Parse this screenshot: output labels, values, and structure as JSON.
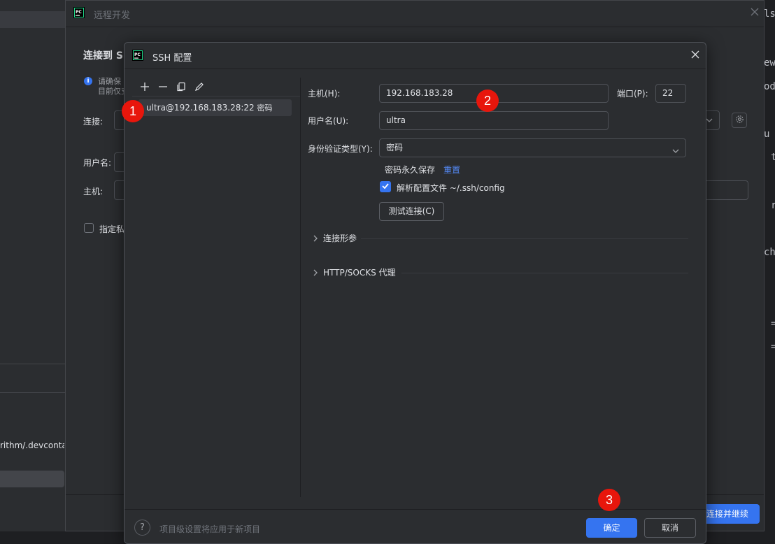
{
  "background": {
    "left_path_text": "rithm/.devcontai",
    "right_code_fragments": [
      "ls",
      "ew",
      "od",
      "u",
      "t",
      "r",
      "ch",
      "=",
      "="
    ]
  },
  "remote_window": {
    "title": "远程开发",
    "heading": "连接到 S",
    "info_line1": "请确保",
    "info_line2": "目前仅支",
    "connection_label": "连接:",
    "username_label": "用户名:",
    "host_label": "主机:",
    "private_key_label": "指定私",
    "continue_button": "连接并继续"
  },
  "ssh_dialog": {
    "title": "SSH 配置",
    "connection_list": [
      {
        "label": "ultra@192.168.183.28:22",
        "auth": "密码"
      }
    ],
    "host_label": "主机(H):",
    "host_value": "192.168.183.28",
    "port_label": "端口(P):",
    "port_value": "22",
    "username_label": "用户名(U):",
    "username_value": "ultra",
    "auth_type_label": "身份验证类型(Y):",
    "auth_type_value": "密码",
    "password_save_text": "密码永久保存",
    "reset_link": "重置",
    "parse_config_label": "解析配置文件 ~/.ssh/config",
    "parse_config_checked": true,
    "test_connection_button": "测试连接(C)",
    "section_connection_params": "连接形参",
    "section_proxy": "HTTP/SOCKS 代理",
    "footer_note": "项目级设置将应用于新项目",
    "ok_button": "确定",
    "cancel_button": "取消"
  },
  "markers": [
    "1",
    "2",
    "3"
  ],
  "colors": {
    "accent": "#3574f0",
    "marker": "#e8160c",
    "dialog_bg": "#2b2d30",
    "link": "#548af7"
  }
}
